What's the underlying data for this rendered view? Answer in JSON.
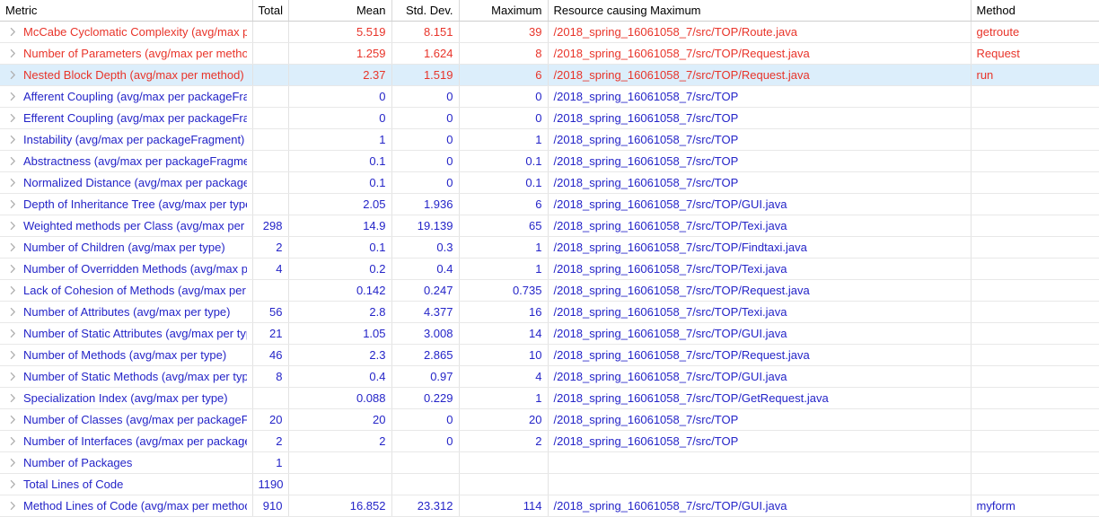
{
  "table": {
    "columns": [
      {
        "key": "metric",
        "label": "Metric",
        "align": "left"
      },
      {
        "key": "total",
        "label": "Total",
        "align": "right"
      },
      {
        "key": "mean",
        "label": "Mean",
        "align": "right"
      },
      {
        "key": "stddev",
        "label": "Std. Dev.",
        "align": "right"
      },
      {
        "key": "maximum",
        "label": "Maximum",
        "align": "right"
      },
      {
        "key": "resource",
        "label": "Resource causing Maximum",
        "align": "left"
      },
      {
        "key": "method",
        "label": "Method",
        "align": "left"
      }
    ],
    "colors": {
      "value_red": "#e8342a",
      "value_blue": "#2424c8",
      "selected_row": "#dceefb",
      "header_text": "#000000",
      "grid_line": "#e3e3e3",
      "chevron": "#b0b0b0"
    },
    "expand_icon": "chevron-right-icon",
    "selected_row_index": 2,
    "rows": [
      {
        "metric": "McCabe Cyclomatic Complexity (avg/max per method)",
        "total": "",
        "mean": "5.519",
        "stddev": "8.151",
        "maximum": "39",
        "resource": "/2018_spring_16061058_7/src/TOP/Route.java",
        "method": "getroute",
        "color": "red",
        "selected": false
      },
      {
        "metric": "Number of Parameters (avg/max per method)",
        "total": "",
        "mean": "1.259",
        "stddev": "1.624",
        "maximum": "8",
        "resource": "/2018_spring_16061058_7/src/TOP/Request.java",
        "method": "Request",
        "color": "red",
        "selected": false
      },
      {
        "metric": "Nested Block Depth (avg/max per method)",
        "total": "",
        "mean": "2.37",
        "stddev": "1.519",
        "maximum": "6",
        "resource": "/2018_spring_16061058_7/src/TOP/Request.java",
        "method": "run",
        "color": "red",
        "selected": true
      },
      {
        "metric": "Afferent Coupling (avg/max per packageFragment)",
        "total": "",
        "mean": "0",
        "stddev": "0",
        "maximum": "0",
        "resource": "/2018_spring_16061058_7/src/TOP",
        "method": "",
        "color": "blue",
        "selected": false
      },
      {
        "metric": "Efferent Coupling (avg/max per packageFragment)",
        "total": "",
        "mean": "0",
        "stddev": "0",
        "maximum": "0",
        "resource": "/2018_spring_16061058_7/src/TOP",
        "method": "",
        "color": "blue",
        "selected": false
      },
      {
        "metric": "Instability (avg/max per packageFragment)",
        "total": "",
        "mean": "1",
        "stddev": "0",
        "maximum": "1",
        "resource": "/2018_spring_16061058_7/src/TOP",
        "method": "",
        "color": "blue",
        "selected": false
      },
      {
        "metric": "Abstractness (avg/max per packageFragment)",
        "total": "",
        "mean": "0.1",
        "stddev": "0",
        "maximum": "0.1",
        "resource": "/2018_spring_16061058_7/src/TOP",
        "method": "",
        "color": "blue",
        "selected": false
      },
      {
        "metric": "Normalized Distance (avg/max per packageFragment)",
        "total": "",
        "mean": "0.1",
        "stddev": "0",
        "maximum": "0.1",
        "resource": "/2018_spring_16061058_7/src/TOP",
        "method": "",
        "color": "blue",
        "selected": false
      },
      {
        "metric": "Depth of Inheritance Tree (avg/max per type)",
        "total": "",
        "mean": "2.05",
        "stddev": "1.936",
        "maximum": "6",
        "resource": "/2018_spring_16061058_7/src/TOP/GUI.java",
        "method": "",
        "color": "blue",
        "selected": false
      },
      {
        "metric": "Weighted methods per Class (avg/max per type)",
        "total": "298",
        "mean": "14.9",
        "stddev": "19.139",
        "maximum": "65",
        "resource": "/2018_spring_16061058_7/src/TOP/Texi.java",
        "method": "",
        "color": "blue",
        "selected": false
      },
      {
        "metric": "Number of Children (avg/max per type)",
        "total": "2",
        "mean": "0.1",
        "stddev": "0.3",
        "maximum": "1",
        "resource": "/2018_spring_16061058_7/src/TOP/Findtaxi.java",
        "method": "",
        "color": "blue",
        "selected": false
      },
      {
        "metric": "Number of Overridden Methods (avg/max per type)",
        "total": "4",
        "mean": "0.2",
        "stddev": "0.4",
        "maximum": "1",
        "resource": "/2018_spring_16061058_7/src/TOP/Texi.java",
        "method": "",
        "color": "blue",
        "selected": false
      },
      {
        "metric": "Lack of Cohesion of Methods (avg/max per type)",
        "total": "",
        "mean": "0.142",
        "stddev": "0.247",
        "maximum": "0.735",
        "resource": "/2018_spring_16061058_7/src/TOP/Request.java",
        "method": "",
        "color": "blue",
        "selected": false
      },
      {
        "metric": "Number of Attributes (avg/max per type)",
        "total": "56",
        "mean": "2.8",
        "stddev": "4.377",
        "maximum": "16",
        "resource": "/2018_spring_16061058_7/src/TOP/Texi.java",
        "method": "",
        "color": "blue",
        "selected": false
      },
      {
        "metric": "Number of Static Attributes (avg/max per type)",
        "total": "21",
        "mean": "1.05",
        "stddev": "3.008",
        "maximum": "14",
        "resource": "/2018_spring_16061058_7/src/TOP/GUI.java",
        "method": "",
        "color": "blue",
        "selected": false
      },
      {
        "metric": "Number of Methods (avg/max per type)",
        "total": "46",
        "mean": "2.3",
        "stddev": "2.865",
        "maximum": "10",
        "resource": "/2018_spring_16061058_7/src/TOP/Request.java",
        "method": "",
        "color": "blue",
        "selected": false
      },
      {
        "metric": "Number of Static Methods (avg/max per type)",
        "total": "8",
        "mean": "0.4",
        "stddev": "0.97",
        "maximum": "4",
        "resource": "/2018_spring_16061058_7/src/TOP/GUI.java",
        "method": "",
        "color": "blue",
        "selected": false
      },
      {
        "metric": "Specialization Index (avg/max per type)",
        "total": "",
        "mean": "0.088",
        "stddev": "0.229",
        "maximum": "1",
        "resource": "/2018_spring_16061058_7/src/TOP/GetRequest.java",
        "method": "",
        "color": "blue",
        "selected": false
      },
      {
        "metric": "Number of Classes (avg/max per packageFragment)",
        "total": "20",
        "mean": "20",
        "stddev": "0",
        "maximum": "20",
        "resource": "/2018_spring_16061058_7/src/TOP",
        "method": "",
        "color": "blue",
        "selected": false
      },
      {
        "metric": "Number of Interfaces (avg/max per packageFragment)",
        "total": "2",
        "mean": "2",
        "stddev": "0",
        "maximum": "2",
        "resource": "/2018_spring_16061058_7/src/TOP",
        "method": "",
        "color": "blue",
        "selected": false
      },
      {
        "metric": "Number of Packages",
        "total": "1",
        "mean": "",
        "stddev": "",
        "maximum": "",
        "resource": "",
        "method": "",
        "color": "blue",
        "selected": false
      },
      {
        "metric": "Total Lines of Code",
        "total": "1190",
        "mean": "",
        "stddev": "",
        "maximum": "",
        "resource": "",
        "method": "",
        "color": "blue",
        "selected": false
      },
      {
        "metric": "Method Lines of Code (avg/max per method)",
        "total": "910",
        "mean": "16.852",
        "stddev": "23.312",
        "maximum": "114",
        "resource": "/2018_spring_16061058_7/src/TOP/GUI.java",
        "method": "myform",
        "color": "blue",
        "selected": false
      }
    ]
  }
}
